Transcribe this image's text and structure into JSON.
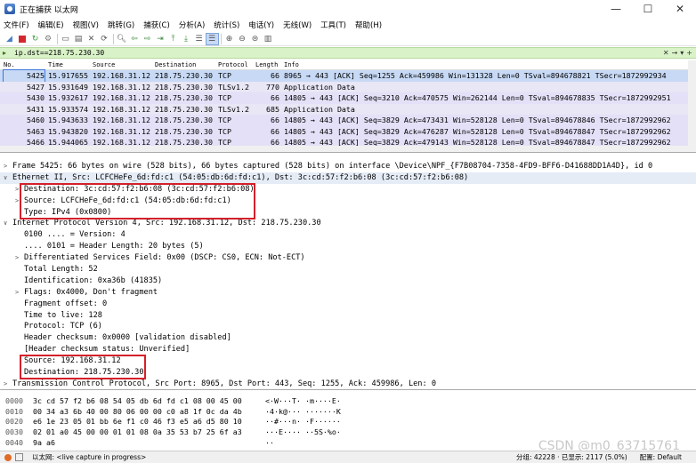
{
  "window": {
    "title": "正在捕获 以太网",
    "buttons": [
      "—",
      "☐",
      "✕"
    ]
  },
  "menu": [
    "文件(F)",
    "编辑(E)",
    "视图(V)",
    "跳转(G)",
    "捕获(C)",
    "分析(A)",
    "统计(S)",
    "电话(Y)",
    "无线(W)",
    "工具(T)",
    "帮助(H)"
  ],
  "filter": {
    "value": "ip.dst==218.75.230.30"
  },
  "columns": [
    "No.",
    "Time",
    "Source",
    "Destination",
    "Protocol",
    "Length",
    "Info"
  ],
  "packets": [
    {
      "no": "5425",
      "time": "15.917655",
      "src": "192.168.31.12",
      "dst": "218.75.230.30",
      "proto": "TCP",
      "len": "66",
      "info": "8965 → 443 [ACK] Seq=1255 Ack=459986 Win=131328 Len=0 TSval=894678821 TSecr=1872992934",
      "style": "sel"
    },
    {
      "no": "5427",
      "time": "15.931649",
      "src": "192.168.31.12",
      "dst": "218.75.230.30",
      "proto": "TLSv1.2",
      "len": "770",
      "info": "Application Data",
      "style": "tls"
    },
    {
      "no": "5430",
      "time": "15.932617",
      "src": "192.168.31.12",
      "dst": "218.75.230.30",
      "proto": "TCP",
      "len": "66",
      "info": "14805 → 443 [ACK] Seq=3210 Ack=470575 Win=262144 Len=0 TSval=894678835 TSecr=1872992951",
      "style": "ack"
    },
    {
      "no": "5431",
      "time": "15.933574",
      "src": "192.168.31.12",
      "dst": "218.75.230.30",
      "proto": "TLSv1.2",
      "len": "685",
      "info": "Application Data",
      "style": "tls"
    },
    {
      "no": "5460",
      "time": "15.943633",
      "src": "192.168.31.12",
      "dst": "218.75.230.30",
      "proto": "TCP",
      "len": "66",
      "info": "14805 → 443 [ACK] Seq=3829 Ack=473431 Win=528128 Len=0 TSval=894678846 TSecr=1872992962",
      "style": "ack"
    },
    {
      "no": "5463",
      "time": "15.943820",
      "src": "192.168.31.12",
      "dst": "218.75.230.30",
      "proto": "TCP",
      "len": "66",
      "info": "14805 → 443 [ACK] Seq=3829 Ack=476287 Win=528128 Len=0 TSval=894678847 TSecr=1872992962",
      "style": "ack"
    },
    {
      "no": "5466",
      "time": "15.944065",
      "src": "192.168.31.12",
      "dst": "218.75.230.30",
      "proto": "TCP",
      "len": "66",
      "info": "14805 → 443 [ACK] Seq=3829 Ack=479143 Win=528128 Len=0 TSval=894678847 TSecr=1872992962",
      "style": "ack"
    }
  ],
  "details": [
    {
      "level": 1,
      "arrow": ">",
      "text": "Frame 5425: 66 bytes on wire (528 bits), 66 bytes captured (528 bits) on interface \\Device\\NPF_{F7B08704-7358-4FD9-BFF6-D41688DD1A4D}, id 0"
    },
    {
      "level": 1,
      "arrow": "∨",
      "text": "Ethernet II, Src: LCFCHeFe_6d:fd:c1 (54:05:db:6d:fd:c1), Dst: 3c:cd:57:f2:b6:08 (3c:cd:57:f2:b6:08)",
      "cls": "eth"
    },
    {
      "level": 2,
      "arrow": ">",
      "text": "Destination: 3c:cd:57:f2:b6:08 (3c:cd:57:f2:b6:08)"
    },
    {
      "level": 2,
      "arrow": ">",
      "text": "Source: LCFCHeFe_6d:fd:c1 (54:05:db:6d:fd:c1)"
    },
    {
      "level": 2,
      "arrow": "",
      "text": "Type: IPv4 (0x0800)"
    },
    {
      "level": 1,
      "arrow": "∨",
      "text": "Internet Protocol Version 4, Src: 192.168.31.12, Dst: 218.75.230.30"
    },
    {
      "level": 2,
      "arrow": "",
      "text": "0100 .... = Version: 4"
    },
    {
      "level": 2,
      "arrow": "",
      "text": ".... 0101 = Header Length: 20 bytes (5)"
    },
    {
      "level": 2,
      "arrow": ">",
      "text": "Differentiated Services Field: 0x00 (DSCP: CS0, ECN: Not-ECT)"
    },
    {
      "level": 2,
      "arrow": "",
      "text": "Total Length: 52"
    },
    {
      "level": 2,
      "arrow": "",
      "text": "Identification: 0xa36b (41835)"
    },
    {
      "level": 2,
      "arrow": ">",
      "text": "Flags: 0x4000, Don't fragment"
    },
    {
      "level": 2,
      "arrow": "",
      "text": "Fragment offset: 0"
    },
    {
      "level": 2,
      "arrow": "",
      "text": "Time to live: 128"
    },
    {
      "level": 2,
      "arrow": "",
      "text": "Protocol: TCP (6)"
    },
    {
      "level": 2,
      "arrow": "",
      "text": "Header checksum: 0x0000 [validation disabled]"
    },
    {
      "level": 2,
      "arrow": "",
      "text": "[Header checksum status: Unverified]"
    },
    {
      "level": 2,
      "arrow": "",
      "text": "Source: 192.168.31.12"
    },
    {
      "level": 2,
      "arrow": "",
      "text": "Destination: 218.75.230.30"
    },
    {
      "level": 1,
      "arrow": ">",
      "text": "Transmission Control Protocol, Src Port: 8965, Dst Port: 443, Seq: 1255, Ack: 459986, Len: 0"
    }
  ],
  "bytes": [
    {
      "off": "0000",
      "hex": "3c cd 57 f2 b6 08 54 05  db 6d fd c1 08 00 45 00",
      "ascii": "<·W···T· ·m····E·"
    },
    {
      "off": "0010",
      "hex": "00 34 a3 6b 40 00 80 06  00 00 c0 a8 1f 0c da 4b",
      "ascii": "·4·k@··· ·······K"
    },
    {
      "off": "0020",
      "hex": "e6 1e 23 05 01 bb 6e f1  c0 46 f3 e5 a6 d5 80 10",
      "ascii": "··#···n· ·F······"
    },
    {
      "off": "0030",
      "hex": "02 01 a0 45 00 00 01 01  08 0a 35 53 b7 25 6f a3",
      "ascii": "···E···· ··5S·%o·"
    },
    {
      "off": "0040",
      "hex": "9a a6",
      "ascii": "··"
    }
  ],
  "status": {
    "capture": "以太网: <live capture in progress>",
    "stats": "分组: 42228 · 已显示: 2117 (5.0%)",
    "profile": "配置: Default"
  },
  "watermark": "CSDN @m0_63715761"
}
